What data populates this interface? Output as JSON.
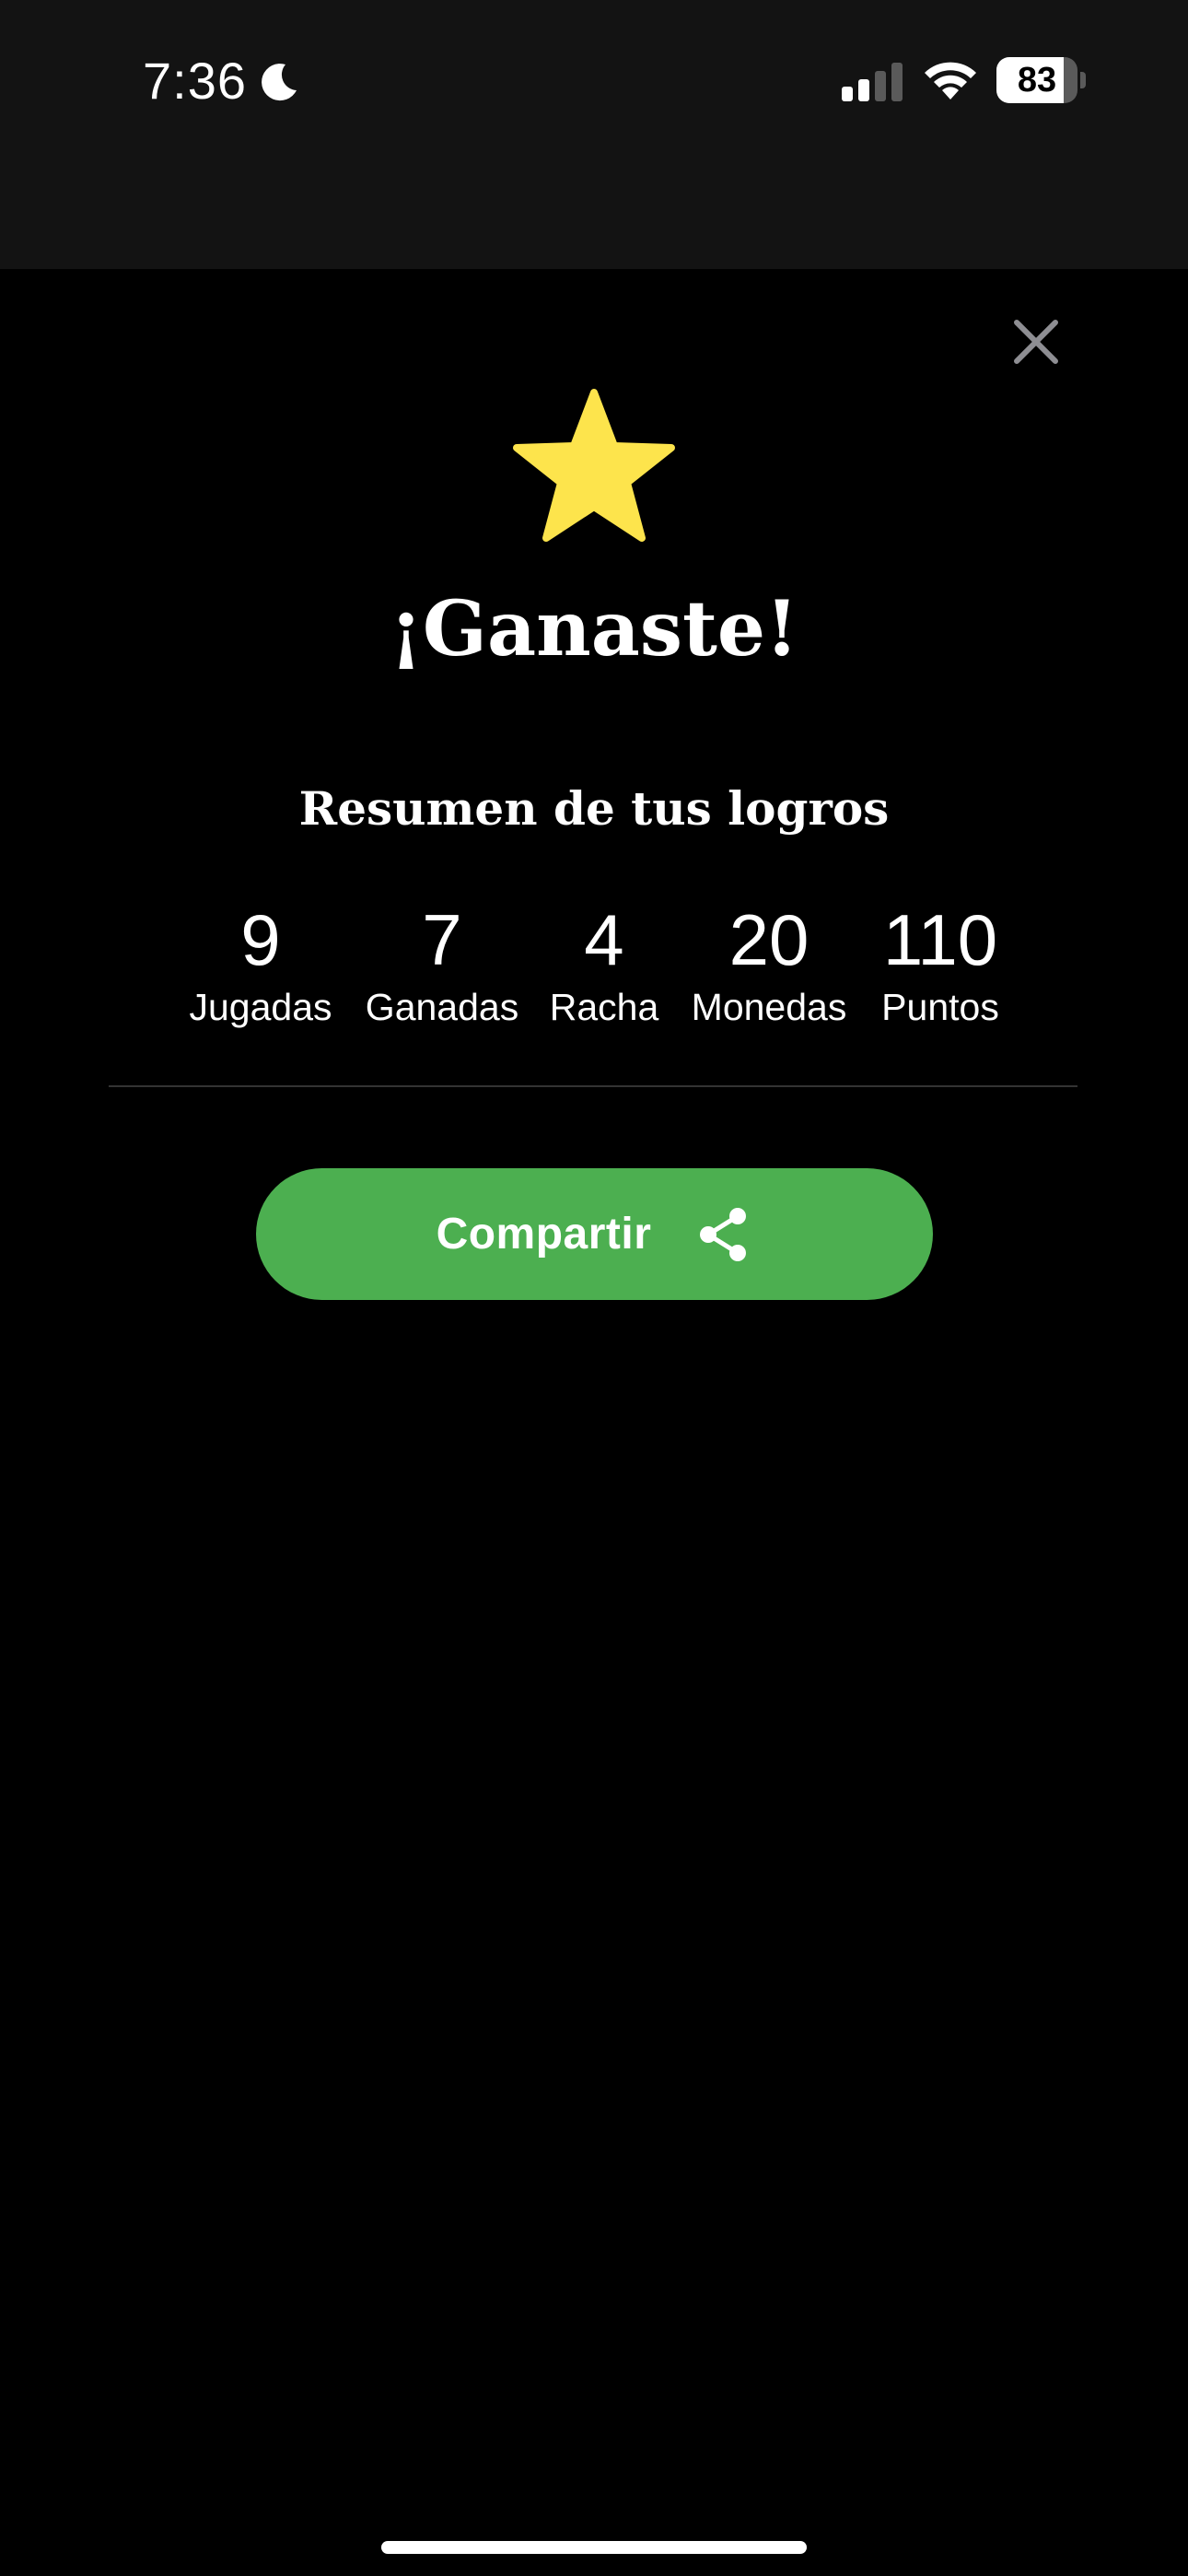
{
  "status_bar": {
    "time": "7:36",
    "battery_level": "83",
    "icons": [
      "moon-icon",
      "signal-icon",
      "wifi-icon",
      "battery-icon"
    ]
  },
  "modal": {
    "close_icon": "close-icon",
    "star_icon": "star-icon",
    "title": "¡Ganaste!",
    "subtitle": "Resumen de tus logros",
    "stats": [
      {
        "value": "9",
        "label": "Jugadas"
      },
      {
        "value": "7",
        "label": "Ganadas"
      },
      {
        "value": "4",
        "label": "Racha"
      },
      {
        "value": "20",
        "label": "Monedas"
      },
      {
        "value": "110",
        "label": "Puntos"
      }
    ],
    "share_button": {
      "label": "Compartir",
      "icon": "share-icon"
    }
  },
  "colors": {
    "background": "#000000",
    "status_bar": "#131313",
    "star": "#fde44c",
    "share_button": "#4caf50",
    "close_icon": "#8e8e93",
    "divider": "#333333"
  }
}
